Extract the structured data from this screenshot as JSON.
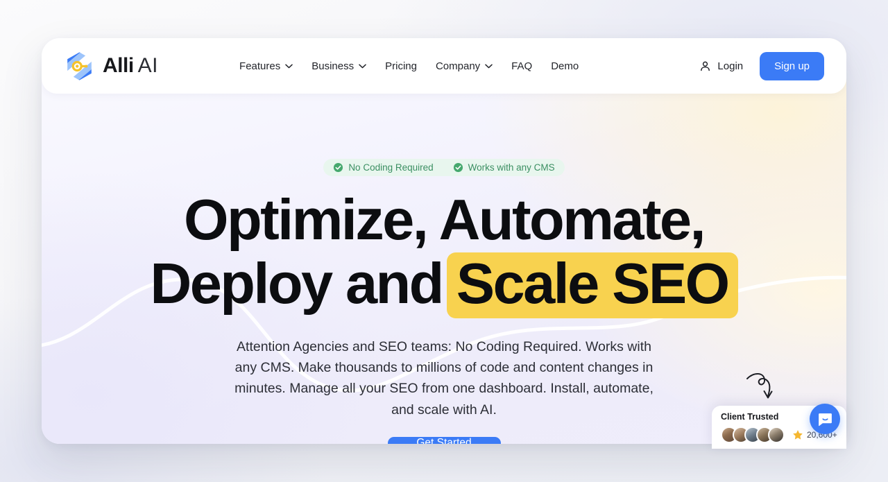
{
  "brand": {
    "name_bold": "Alli",
    "name_light": "AI",
    "logo_icon": "alli-hexagon-logo"
  },
  "nav": {
    "items": [
      {
        "label": "Features",
        "has_dropdown": true
      },
      {
        "label": "Business",
        "has_dropdown": true
      },
      {
        "label": "Pricing",
        "has_dropdown": false
      },
      {
        "label": "Company",
        "has_dropdown": true
      },
      {
        "label": "FAQ",
        "has_dropdown": false
      },
      {
        "label": "Demo",
        "has_dropdown": false
      }
    ],
    "login_label": "Login",
    "login_icon": "user-icon",
    "signup_label": "Sign up"
  },
  "hero": {
    "badges": [
      {
        "label": "No Coding Required",
        "icon": "check-circle-icon"
      },
      {
        "label": "Works with any CMS",
        "icon": "check-circle-icon"
      }
    ],
    "headline_line1": "Optimize, Automate,",
    "headline_line2_plain": "Deploy and",
    "headline_line2_highlight": "Scale SEO",
    "subtext": "Attention Agencies and SEO teams: No Coding Required. Works with any CMS. Make thousands to millions of code and content changes in minutes. Manage all your SEO from one dashboard. Install, automate, and scale with AI.",
    "cta_label": "Get Started"
  },
  "widget": {
    "client_title": "Client Trusted",
    "rating_count": "20,600+",
    "star_icon": "star-icon",
    "chat_icon": "chat-bubble-icon",
    "arrow_icon": "curved-arrow-icon",
    "avatar_count": 5
  },
  "colors": {
    "accent_blue": "#3b7bf6",
    "highlight_yellow": "#f8d24f",
    "badge_green": "#3b8f62",
    "badge_bg": "#e8f6ee",
    "star_gold": "#f5b731"
  }
}
